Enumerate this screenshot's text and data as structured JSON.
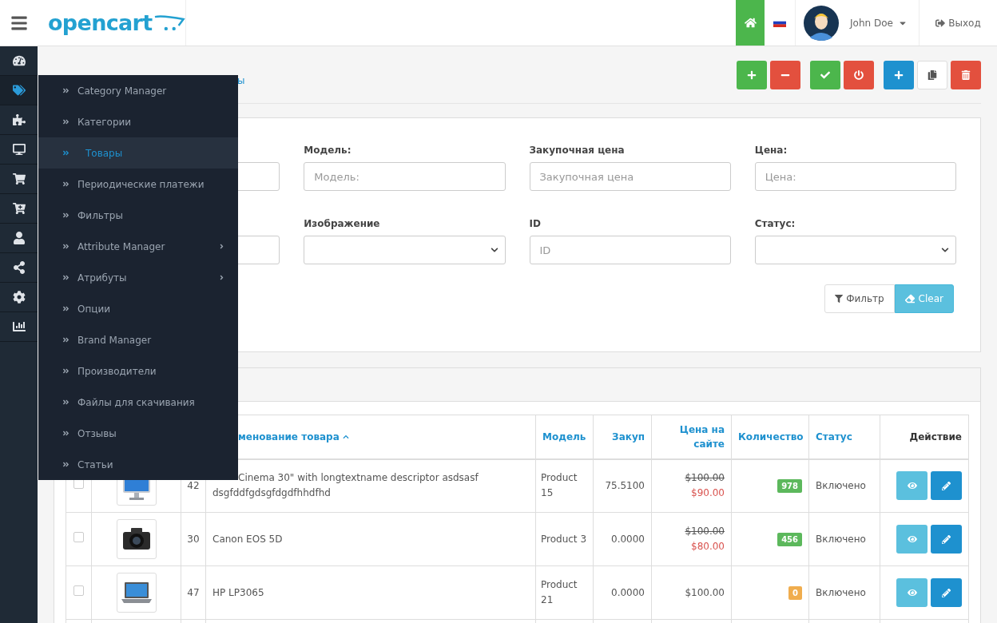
{
  "header": {
    "logo": "opencart",
    "user_name": "John Doe",
    "logout": "Выход"
  },
  "sidebar": {
    "items": [
      {
        "kind": "dashboard",
        "selected": false
      },
      {
        "kind": "catalog",
        "selected": true
      },
      {
        "kind": "extensions",
        "selected": false
      },
      {
        "kind": "design",
        "selected": false
      },
      {
        "kind": "sales",
        "selected": false
      },
      {
        "kind": "cart-plus",
        "selected": false
      },
      {
        "kind": "customers",
        "selected": false
      },
      {
        "kind": "marketing",
        "selected": false
      },
      {
        "kind": "system",
        "selected": false
      },
      {
        "kind": "reports",
        "selected": false
      }
    ]
  },
  "submenu": {
    "items": [
      {
        "label": "Category Manager",
        "selected": false,
        "has_children": false
      },
      {
        "label": "Категории",
        "selected": false,
        "has_children": false
      },
      {
        "label": "Товары",
        "selected": true,
        "has_children": false
      },
      {
        "label": "Периодические платежи",
        "selected": false,
        "has_children": false
      },
      {
        "label": "Фильтры",
        "selected": false,
        "has_children": false
      },
      {
        "label": "Attribute Manager",
        "selected": false,
        "has_children": true
      },
      {
        "label": "Атрибуты",
        "selected": false,
        "has_children": true
      },
      {
        "label": "Опции",
        "selected": false,
        "has_children": false
      },
      {
        "label": "Brand Manager",
        "selected": false,
        "has_children": false
      },
      {
        "label": "Производители",
        "selected": false,
        "has_children": false
      },
      {
        "label": "Файлы для скачивания",
        "selected": false,
        "has_children": false
      },
      {
        "label": "Отзывы",
        "selected": false,
        "has_children": false
      },
      {
        "label": "Статьи",
        "selected": false,
        "has_children": false
      }
    ]
  },
  "page": {
    "breadcrumb_fragment": "ы"
  },
  "toolbar": [
    {
      "kind": "plus",
      "color": "#4cb64c"
    },
    {
      "kind": "minus",
      "color": "#e3503e"
    },
    {
      "kind": "check",
      "color": "#4cb64c"
    },
    {
      "kind": "power",
      "color": "#e3503e"
    },
    {
      "kind": "plus",
      "color": "#1e91cf"
    },
    {
      "kind": "copy",
      "color": "#ffffff"
    },
    {
      "kind": "trash",
      "color": "#e3503e"
    }
  ],
  "filter": {
    "fields": [
      {
        "kind": "text"
      },
      {
        "kind": "text",
        "label": "Модель:",
        "placeholder": "Модель:"
      },
      {
        "kind": "text",
        "label": "Закупочная цена",
        "placeholder": "Закупочная цена"
      },
      {
        "kind": "text",
        "label": "Цена:",
        "placeholder": "Цена:"
      },
      {
        "kind": "text"
      },
      {
        "kind": "select",
        "label": "Изображение"
      },
      {
        "kind": "text",
        "label": "ID",
        "placeholder": "ID"
      },
      {
        "kind": "select",
        "label": "Статус:"
      }
    ],
    "filter_button": "Фильтр",
    "clear_button": "Clear"
  },
  "table": {
    "columns": [
      {
        "label": "менование товара",
        "sortable": true,
        "sorted": true
      },
      {
        "label": "Модель",
        "sortable": true,
        "sorted": false
      },
      {
        "label": "Закуп",
        "sortable": true,
        "sorted": false
      },
      {
        "label": "Цена на сайте",
        "sortable": true,
        "sorted": false
      },
      {
        "label": "Количество",
        "sortable": true,
        "sorted": false
      },
      {
        "label": "Статус",
        "sortable": true,
        "sorted": false
      },
      {
        "label": "Действие",
        "sortable": false,
        "sorted": false
      }
    ],
    "rows": [
      {
        "checked": false,
        "id": "42",
        "name": "Cinema 30\" with longtextname descriptor asdsasf dsgfddfgdsgfdgdfhhdfhd",
        "name_cut": true,
        "model": "Product 15",
        "cost": "75.5100",
        "old_price": "$100.00",
        "price": "$90.00",
        "quantity": "978",
        "color": "#5cb85c",
        "status": "Включено"
      },
      {
        "checked": false,
        "id": "30",
        "name": "Canon EOS 5D",
        "name_cut": false,
        "model": "Product 3",
        "cost": "0.0000",
        "old_price": "$100.00",
        "price": "$80.00",
        "quantity": "456",
        "color": "#5cb85c",
        "status": "Включено"
      },
      {
        "checked": false,
        "id": "47",
        "name": "HP LP3065",
        "name_cut": false,
        "model": "Product 21",
        "cost": "0.0000",
        "price": "$100.00",
        "quantity": "0",
        "color": "#f0ad4e",
        "status": "Включено"
      }
    ]
  }
}
